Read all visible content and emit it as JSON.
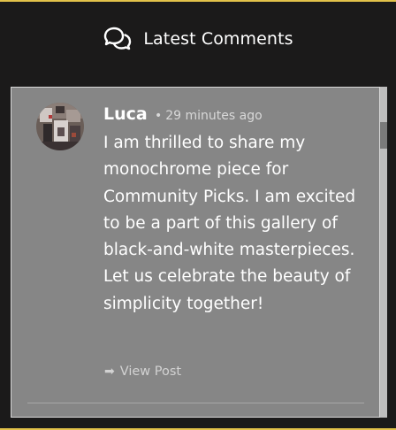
{
  "header": {
    "title": "Latest Comments",
    "icon": "comments-icon"
  },
  "comment": {
    "author": "Luca",
    "time": "29 minutes ago",
    "separator": "•",
    "body": "I am thrilled to share my monochrome piece for Community Picks. I am excited to be a part of this gallery of black-and-white masterpieces. Let us celebrate the beauty of simplicity together!",
    "link_label": "View Post",
    "link_icon": "arrow-right-icon"
  },
  "colors": {
    "background": "#1b1a1a",
    "accent_border": "#e2c24a",
    "panel": "#868686"
  }
}
